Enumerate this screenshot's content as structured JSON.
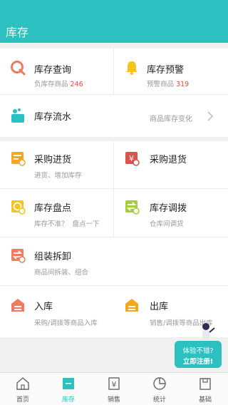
{
  "header": {
    "title": "库存"
  },
  "inventory": {
    "query": {
      "title": "库存查询",
      "sub_label": "负库存商品",
      "sub_count": "246"
    },
    "warning": {
      "title": "库存预警",
      "sub_label": "预警商品",
      "sub_count": "319"
    },
    "flow": {
      "title": "库存流水",
      "right_text": "商品库存变化"
    }
  },
  "operations": {
    "purchase_in": {
      "title": "采购进货",
      "sub": "进货、增加库存"
    },
    "purchase_return": {
      "title": "采购退货"
    },
    "stock_check": {
      "title": "库存盘点",
      "sub": "库存不准？  盘点一下"
    },
    "stock_transfer": {
      "title": "库存调拨",
      "sub": "仓库间调货"
    },
    "assembly": {
      "title": "组装拆卸",
      "sub": "商品间拆装、组合"
    },
    "inbound": {
      "title": "入库",
      "sub": "采购/调拨等商品入库"
    },
    "outbound": {
      "title": "出库",
      "sub": "销售/调拨等商品出库"
    }
  },
  "promo": {
    "line1": "体验不错?",
    "line2": "立即注册!"
  },
  "tabs": [
    {
      "label": "首页"
    },
    {
      "label": "库存"
    },
    {
      "label": "销售"
    },
    {
      "label": "统计"
    },
    {
      "label": "基础"
    }
  ],
  "colors": {
    "accent": "#2cc0c0",
    "highlight": "#e74c3c",
    "orange": "#f5a623",
    "yellow": "#f5c518",
    "green": "#a6cc3a",
    "salmon": "#f07b5e"
  }
}
